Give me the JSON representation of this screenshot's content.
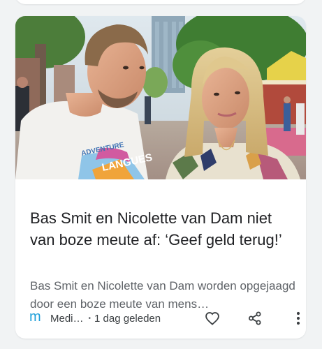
{
  "article": {
    "headline": "Bas Smit en Nicolette van Dam niet van boze meute af: ‘Geef geld terug!’",
    "snippet": "Bas Smit en Nicolette van Dam worden opgejaagd door een boze meute van mens…",
    "shirt_text": "ADVENTURE\nLANGUES",
    "source": {
      "logo_letter": "m",
      "name": "Medi…"
    },
    "separator": "•",
    "time": "1 dag geleden"
  },
  "icons": {
    "like": "heart-outline-icon",
    "share": "share-icon",
    "more": "more-vert-icon"
  },
  "colors": {
    "background": "#f1f3f4",
    "card": "#ffffff",
    "headline": "#202124",
    "snippet": "#5f6368",
    "source_logo": "#1e9fd9"
  }
}
